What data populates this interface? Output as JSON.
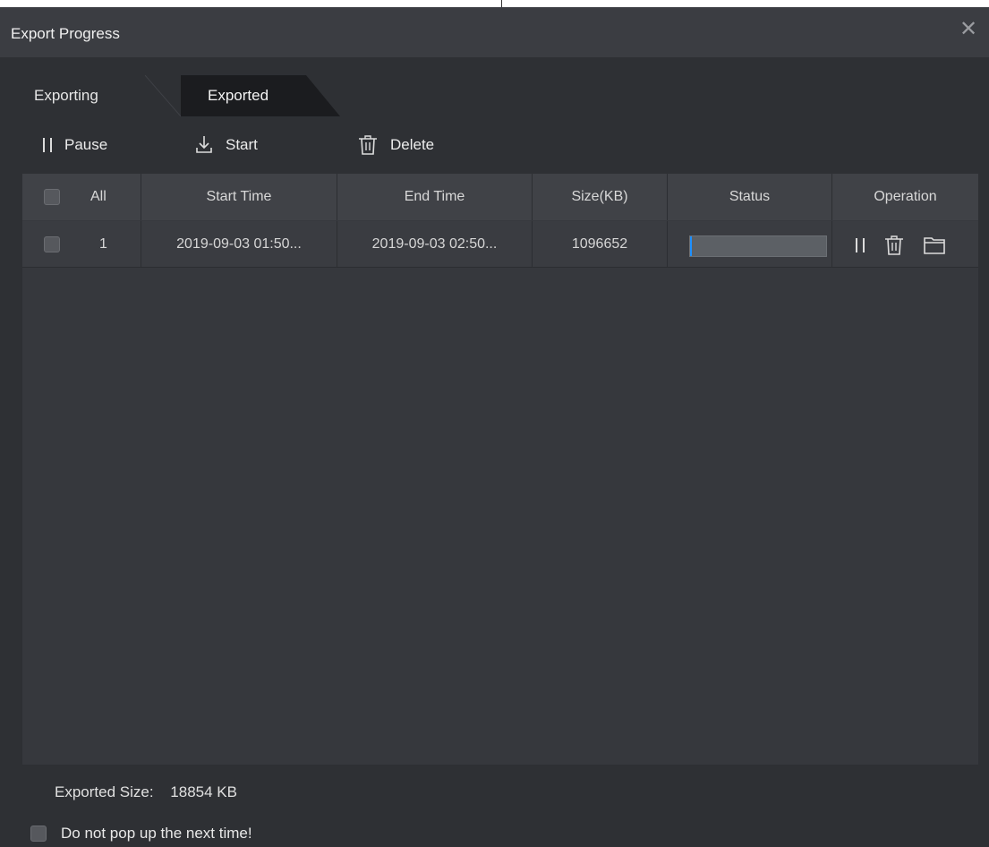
{
  "window": {
    "title": "Export Progress",
    "close_icon": "close-icon"
  },
  "tabs": [
    {
      "label": "Exporting",
      "active": false
    },
    {
      "label": "Exported",
      "active": true
    }
  ],
  "toolbar": {
    "pause_label": "Pause",
    "start_label": "Start",
    "delete_label": "Delete"
  },
  "table": {
    "columns": [
      "All",
      "Start Time",
      "End Time",
      "Size(KB)",
      "Status",
      "Operation"
    ],
    "rows": [
      {
        "index": "1",
        "start_time": "2019-09-03 01:50...",
        "end_time": "2019-09-03 02:50...",
        "size": "1096652",
        "progress": 0.01,
        "operations": [
          "pause-icon",
          "trash-icon",
          "folder-icon"
        ]
      }
    ]
  },
  "footer": {
    "exported_size_label": "Exported Size:",
    "exported_size_value": "18854 KB",
    "no_popup_label": "Do not pop up the next time!"
  },
  "colors": {
    "background": "#2e3034",
    "titlebar": "#3b3d42",
    "progress_fill": "#1e90ff"
  }
}
